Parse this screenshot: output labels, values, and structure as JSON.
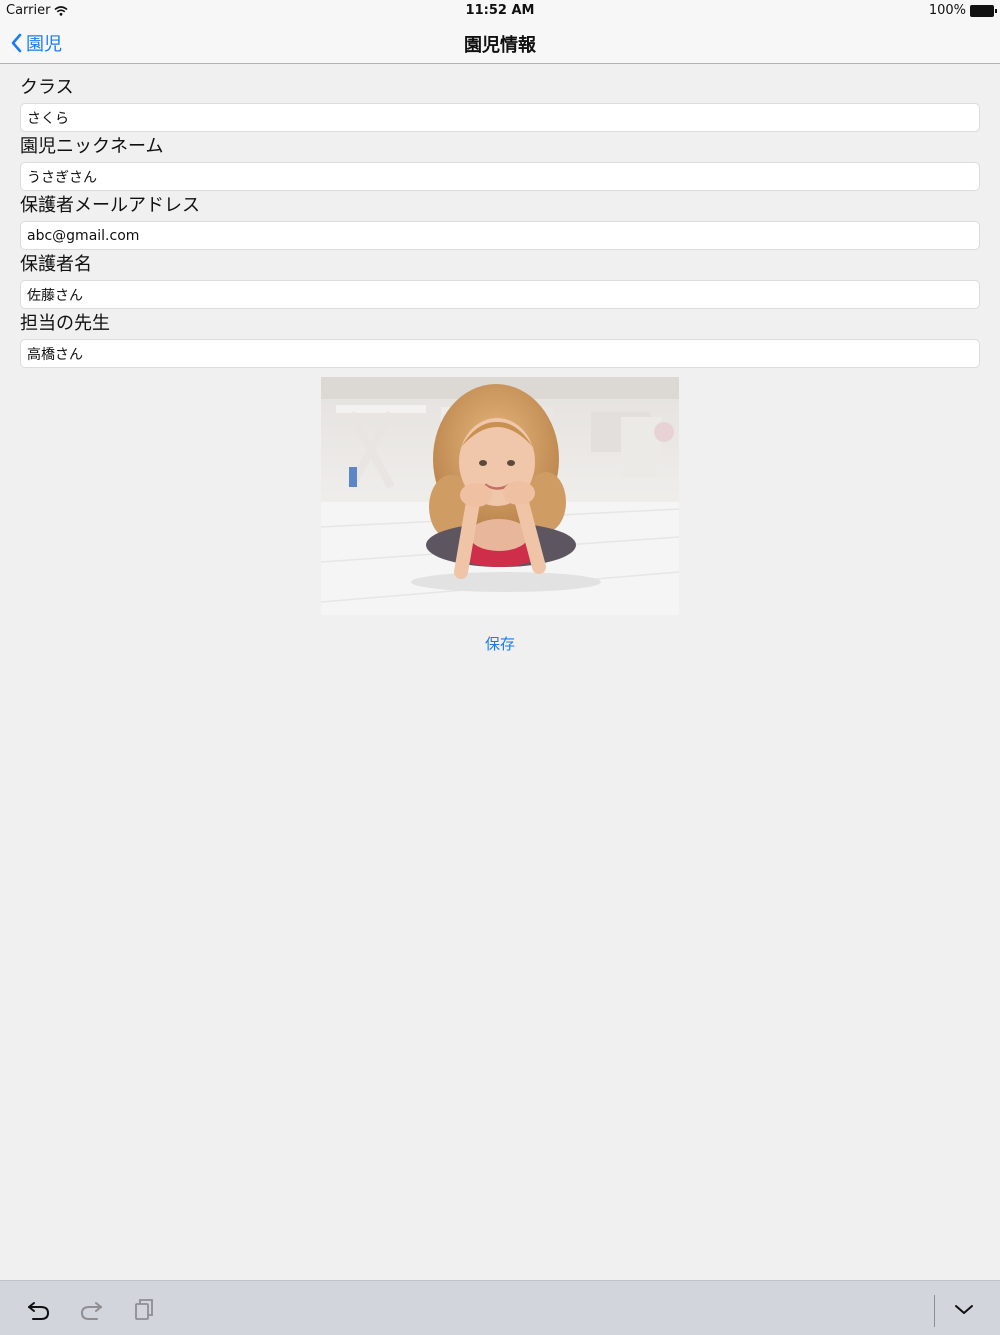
{
  "status_bar": {
    "carrier": "Carrier",
    "time": "11:52 AM",
    "battery": "100%"
  },
  "nav": {
    "back_label": "園児",
    "title": "園児情報"
  },
  "form": {
    "fields": [
      {
        "label": "クラス",
        "value": "さくら"
      },
      {
        "label": "園児ニックネーム",
        "value": "うさぎさん"
      },
      {
        "label": "保護者メールアドレス",
        "value": "abc@gmail.com"
      },
      {
        "label": "保護者名",
        "value": "佐藤さん"
      },
      {
        "label": "担当の先生",
        "value": "高橋さん"
      }
    ]
  },
  "save_label": "保存",
  "icons": {
    "back": "chevron-left-icon",
    "undo": "undo-icon",
    "redo": "redo-icon",
    "paste": "paste-icon",
    "dismiss_keyboard": "chevron-down-icon",
    "wifi": "wifi-icon",
    "battery": "battery-icon"
  },
  "colors": {
    "accent": "#1a7cf5",
    "background": "#f0f0f1",
    "bar": "#f7f7f7",
    "keyboard_bar": "#d2d5db"
  }
}
